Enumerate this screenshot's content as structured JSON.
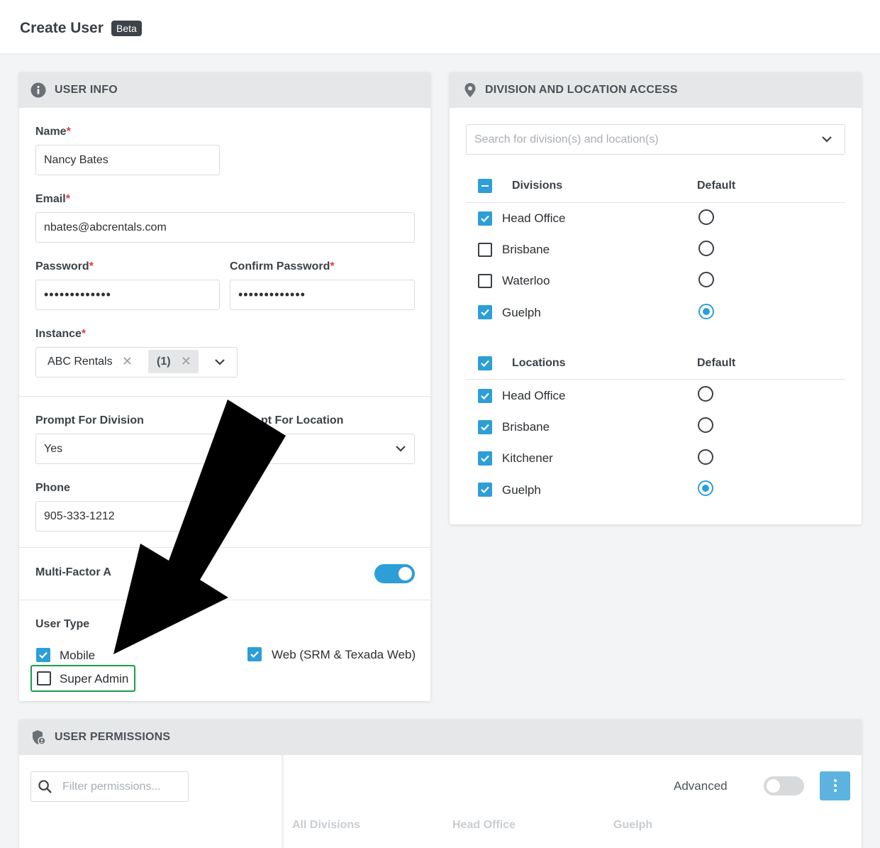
{
  "header": {
    "title": "Create User",
    "badge": "Beta"
  },
  "user_info": {
    "section_title": "USER INFO",
    "name": {
      "label": "Name",
      "required": "*",
      "value": "Nancy Bates"
    },
    "email": {
      "label": "Email",
      "required": "*",
      "value": "nbates@abcrentals.com"
    },
    "password": {
      "label": "Password",
      "required": "*",
      "value": "•••••••••••••"
    },
    "confirm_password": {
      "label": "Confirm Password",
      "required": "*",
      "value": "•••••••••••••"
    },
    "instance": {
      "label": "Instance",
      "required": "*",
      "chip1": "ABC Rentals",
      "chip2": "(1)",
      "remove": "✕"
    },
    "prompt_division": {
      "label": "Prompt For Division",
      "value": "Yes"
    },
    "prompt_location": {
      "label": "pt For Location"
    },
    "phone": {
      "label": "Phone",
      "value": "905-333-1212"
    },
    "mfa": {
      "label": "Multi-Factor A",
      "enabled": true
    },
    "user_type": {
      "label": "User Type",
      "mobile": {
        "label": "Mobile",
        "checked": true
      },
      "web": {
        "label": "Web (SRM & Texada Web)",
        "checked": true
      },
      "super_admin": {
        "label": "Super Admin",
        "checked": false
      }
    }
  },
  "access": {
    "section_title": "DIVISION AND LOCATION ACCESS",
    "search_placeholder": "Search for division(s) and location(s)",
    "divisions": {
      "header": "Divisions",
      "default_header": "Default",
      "rows": [
        {
          "name": "Head Office",
          "checked": true,
          "default": false
        },
        {
          "name": "Brisbane",
          "checked": false,
          "default": false
        },
        {
          "name": "Waterloo",
          "checked": false,
          "default": false
        },
        {
          "name": "Guelph",
          "checked": true,
          "default": true
        }
      ]
    },
    "locations": {
      "header": "Locations",
      "default_header": "Default",
      "rows": [
        {
          "name": "Head Office",
          "checked": true,
          "default": false
        },
        {
          "name": "Brisbane",
          "checked": true,
          "default": false
        },
        {
          "name": "Kitchener",
          "checked": true,
          "default": false
        },
        {
          "name": "Guelph",
          "checked": true,
          "default": true
        }
      ]
    }
  },
  "permissions": {
    "section_title": "USER PERMISSIONS",
    "filter_placeholder": "Filter permissions...",
    "advanced_label": "Advanced",
    "advanced_enabled": false,
    "columns": [
      "All Divisions",
      "Head Office",
      "Guelph"
    ]
  },
  "colors": {
    "accent": "#2d9ed8",
    "highlight": "#1a9e4b",
    "required": "#d64045"
  }
}
